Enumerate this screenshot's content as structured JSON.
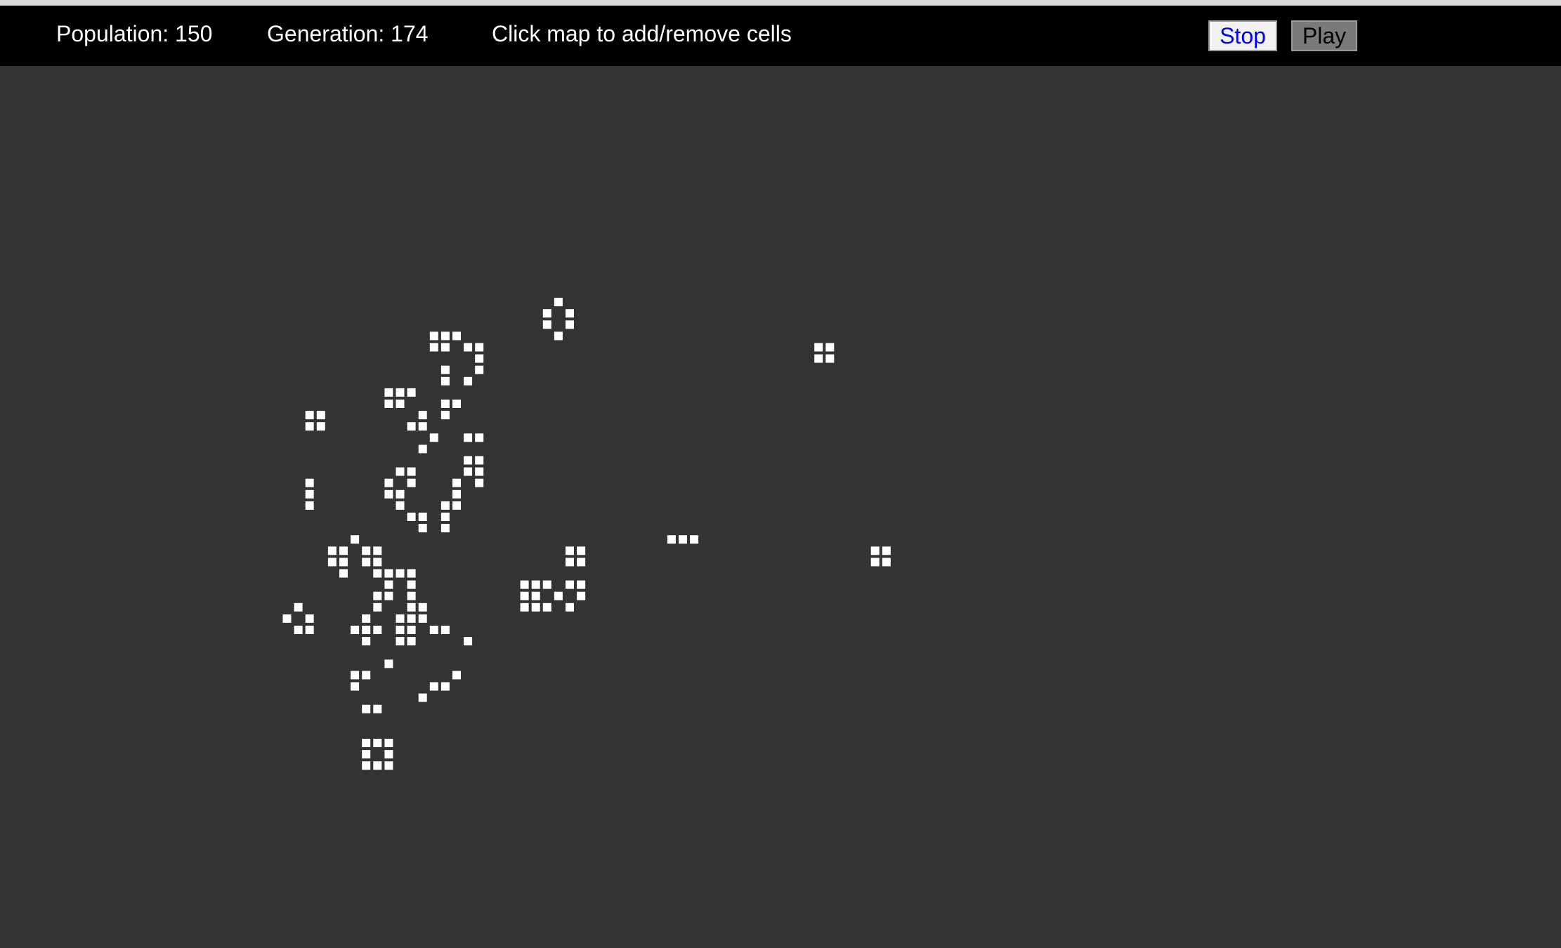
{
  "toolbar": {
    "population": "Population: 150",
    "generation": "Generation: 174",
    "hint": "Click map to add/remove cells",
    "stop_label": "Stop",
    "play_label": "Play"
  },
  "colors": {
    "background": "#333333",
    "toolbar": "#000000",
    "cell": "#ffffff",
    "stop_text": "#0000ee",
    "play_bg": "#7a7a7a"
  },
  "grid": {
    "live_cells": [
      [
        49,
        21
      ],
      [
        48,
        22
      ],
      [
        50,
        22
      ],
      [
        48,
        23
      ],
      [
        50,
        23
      ],
      [
        49,
        24
      ],
      [
        38,
        24
      ],
      [
        39,
        24
      ],
      [
        40,
        24
      ],
      [
        38,
        25
      ],
      [
        39,
        25
      ],
      [
        41,
        25
      ],
      [
        42,
        25
      ],
      [
        42,
        26
      ],
      [
        39,
        27
      ],
      [
        42,
        27
      ],
      [
        39,
        28
      ],
      [
        41,
        28
      ],
      [
        72,
        25
      ],
      [
        73,
        25
      ],
      [
        72,
        26
      ],
      [
        73,
        26
      ],
      [
        34,
        29
      ],
      [
        35,
        29
      ],
      [
        36,
        29
      ],
      [
        34,
        30
      ],
      [
        35,
        30
      ],
      [
        39,
        30
      ],
      [
        40,
        30
      ],
      [
        37,
        31
      ],
      [
        39,
        31
      ],
      [
        27,
        31
      ],
      [
        28,
        31
      ],
      [
        27,
        32
      ],
      [
        28,
        32
      ],
      [
        36,
        32
      ],
      [
        37,
        32
      ],
      [
        38,
        33
      ],
      [
        37,
        34
      ],
      [
        41,
        33
      ],
      [
        42,
        33
      ],
      [
        41,
        35
      ],
      [
        42,
        35
      ],
      [
        41,
        36
      ],
      [
        42,
        36
      ],
      [
        35,
        36
      ],
      [
        36,
        36
      ],
      [
        34,
        37
      ],
      [
        36,
        37
      ],
      [
        40,
        37
      ],
      [
        42,
        37
      ],
      [
        34,
        38
      ],
      [
        35,
        38
      ],
      [
        40,
        38
      ],
      [
        35,
        39
      ],
      [
        39,
        39
      ],
      [
        40,
        39
      ],
      [
        36,
        40
      ],
      [
        37,
        40
      ],
      [
        39,
        40
      ],
      [
        37,
        41
      ],
      [
        39,
        41
      ],
      [
        27,
        37
      ],
      [
        27,
        38
      ],
      [
        27,
        39
      ],
      [
        31,
        42
      ],
      [
        29,
        43
      ],
      [
        30,
        43
      ],
      [
        32,
        43
      ],
      [
        33,
        43
      ],
      [
        29,
        44
      ],
      [
        30,
        44
      ],
      [
        32,
        44
      ],
      [
        33,
        44
      ],
      [
        30,
        45
      ],
      [
        33,
        45
      ],
      [
        34,
        45
      ],
      [
        35,
        45
      ],
      [
        36,
        45
      ],
      [
        34,
        46
      ],
      [
        36,
        46
      ],
      [
        33,
        47
      ],
      [
        34,
        47
      ],
      [
        36,
        47
      ],
      [
        33,
        48
      ],
      [
        36,
        48
      ],
      [
        37,
        48
      ],
      [
        32,
        49
      ],
      [
        35,
        49
      ],
      [
        36,
        49
      ],
      [
        37,
        49
      ],
      [
        31,
        50
      ],
      [
        32,
        50
      ],
      [
        33,
        50
      ],
      [
        35,
        50
      ],
      [
        36,
        50
      ],
      [
        38,
        50
      ],
      [
        39,
        50
      ],
      [
        32,
        51
      ],
      [
        35,
        51
      ],
      [
        36,
        51
      ],
      [
        41,
        51
      ],
      [
        59,
        42
      ],
      [
        60,
        42
      ],
      [
        61,
        42
      ],
      [
        50,
        43
      ],
      [
        51,
        43
      ],
      [
        50,
        44
      ],
      [
        51,
        44
      ],
      [
        77,
        43
      ],
      [
        78,
        43
      ],
      [
        77,
        44
      ],
      [
        78,
        44
      ],
      [
        46,
        46
      ],
      [
        47,
        46
      ],
      [
        48,
        46
      ],
      [
        50,
        46
      ],
      [
        51,
        46
      ],
      [
        46,
        47
      ],
      [
        47,
        47
      ],
      [
        49,
        47
      ],
      [
        51,
        47
      ],
      [
        46,
        48
      ],
      [
        47,
        48
      ],
      [
        48,
        48
      ],
      [
        50,
        48
      ],
      [
        26,
        48
      ],
      [
        25,
        49
      ],
      [
        27,
        49
      ],
      [
        26,
        50
      ],
      [
        27,
        50
      ],
      [
        34,
        53
      ],
      [
        31,
        54
      ],
      [
        32,
        54
      ],
      [
        40,
        54
      ],
      [
        31,
        55
      ],
      [
        38,
        55
      ],
      [
        39,
        55
      ],
      [
        37,
        56
      ],
      [
        32,
        57
      ],
      [
        33,
        57
      ],
      [
        32,
        60
      ],
      [
        33,
        60
      ],
      [
        34,
        60
      ],
      [
        32,
        61
      ],
      [
        34,
        61
      ],
      [
        32,
        62
      ],
      [
        33,
        62
      ],
      [
        34,
        62
      ]
    ]
  }
}
